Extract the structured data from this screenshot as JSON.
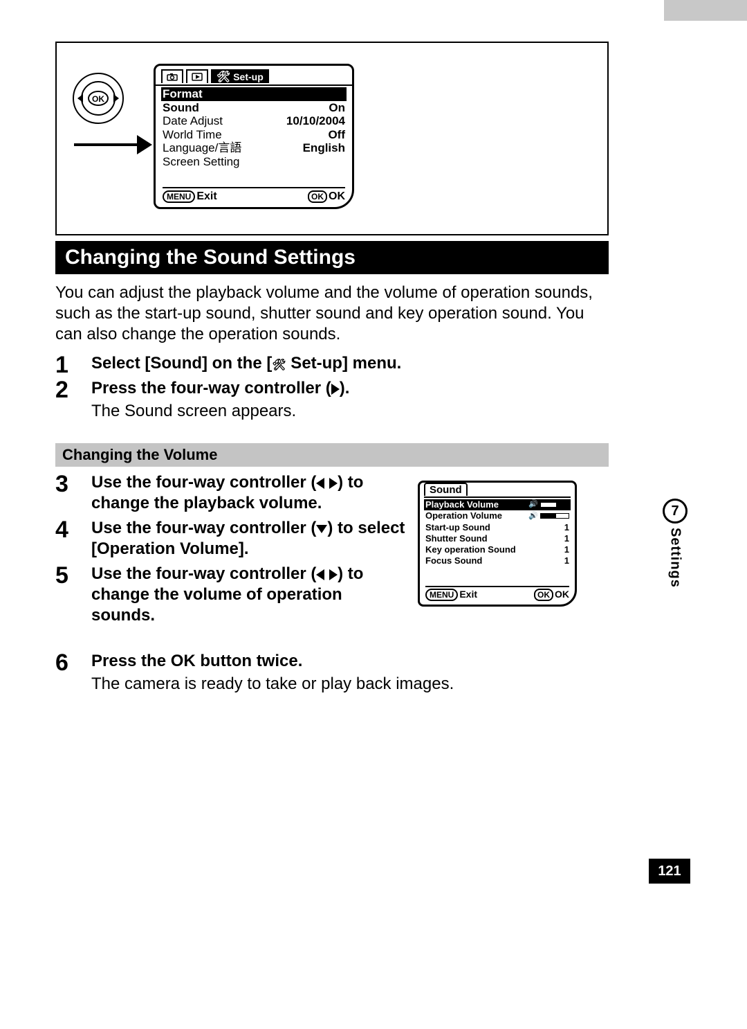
{
  "page_number": "121",
  "side": {
    "chapter_num": "7",
    "chapter_label": "Settings"
  },
  "section_title": "Changing the Sound Settings",
  "intro": "You can adjust the playback volume and the volume of operation sounds, such as the start-up sound, shutter sound and key operation sound. You can also change the operation sounds.",
  "subheading": "Changing the Volume",
  "lcd_setup": {
    "tab_label": "Set-up",
    "rows": {
      "format": {
        "l": "Format",
        "r": ""
      },
      "sound": {
        "l": "Sound",
        "r": "On"
      },
      "date_adjust": {
        "l": "Date Adjust",
        "r": "10/10/2004"
      },
      "world_time": {
        "l": "World Time",
        "r": "Off"
      },
      "language": {
        "l": "Language/言語",
        "r": "English"
      },
      "screen_setting": {
        "l": "Screen Setting",
        "r": ""
      }
    },
    "foot": {
      "menu_btn": "MENU",
      "exit": "Exit",
      "ok_btn": "OK",
      "ok": "OK"
    }
  },
  "lcd_sound": {
    "title": "Sound",
    "rows": {
      "playback_vol": {
        "l": "Playback Volume",
        "icon": "speaker"
      },
      "operation_vol": {
        "l": "Operation Volume",
        "icon": "speaker"
      },
      "startup": {
        "l": "Start-up Sound",
        "r": "1"
      },
      "shutter": {
        "l": "Shutter Sound",
        "r": "1"
      },
      "keyop": {
        "l": "Key operation Sound",
        "r": "1"
      },
      "focus": {
        "l": "Focus Sound",
        "r": "1"
      }
    },
    "foot": {
      "menu_btn": "MENU",
      "exit": "Exit",
      "ok_btn": "OK",
      "ok": "OK"
    }
  },
  "steps": {
    "s1": {
      "n": "1",
      "h_pre": "Select [Sound] on the [",
      "h_post": " Set-up] menu."
    },
    "s2": {
      "n": "2",
      "h_pre": "Press the four-way controller (",
      "h_post": ").",
      "sub": "The Sound screen appears."
    },
    "s3": {
      "n": "3",
      "h_pre": "Use the four-way controller (",
      "h_post": ") to change the playback volume."
    },
    "s4": {
      "n": "4",
      "h_pre": "Use the four-way controller (",
      "h_post": ") to select [Operation Volume]."
    },
    "s5": {
      "n": "5",
      "h_pre": "Use the four-way controller (",
      "h_post": ") to change the volume of operation sounds."
    },
    "s6": {
      "n": "6",
      "h": "Press the OK button twice.",
      "sub": "The camera is ready to take or play back images."
    }
  }
}
